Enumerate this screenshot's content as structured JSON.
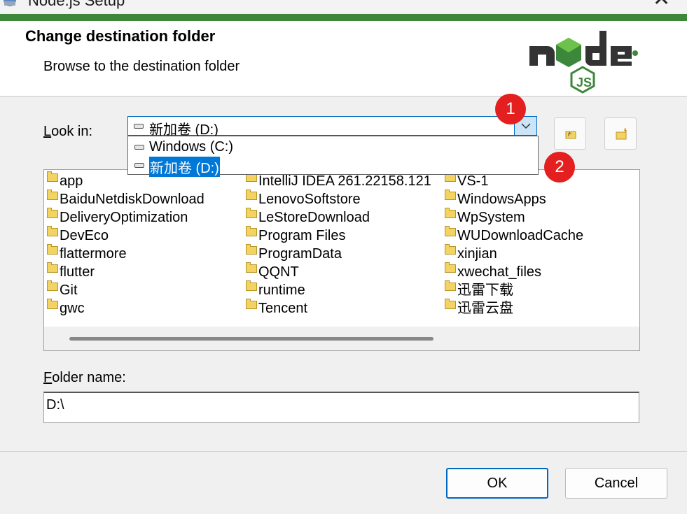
{
  "window": {
    "title": "Node.js Setup",
    "close_glyph": "✕"
  },
  "header": {
    "title": "Change destination folder",
    "subtitle": "Browse to the destination folder",
    "logo_icon": "nodejs-logo-icon"
  },
  "look_in": {
    "label_accel": "L",
    "label_rest": "ook in:",
    "selected": "新加卷 (D:)",
    "options": [
      "Windows (C:)",
      "新加卷 (D:)"
    ]
  },
  "toolbar": {
    "up_icon": "folder-up-icon",
    "new_folder_icon": "new-folder-icon"
  },
  "annotations": {
    "badge1": "1",
    "badge2": "2",
    "badge_color": "#e3201f"
  },
  "folders": {
    "col1": [
      "app",
      "BaiduNetdiskDownload",
      "DeliveryOptimization",
      "DevEco",
      "flattermore",
      "flutter",
      "Git",
      "gwc"
    ],
    "col2": [
      "IntelliJ IDEA 261.22158.121",
      "LenovoSoftstore",
      "LeStoreDownload",
      "Program Files",
      "ProgramData",
      "QQNT",
      "runtime",
      "Tencent"
    ],
    "col3": [
      "VS-1",
      "WindowsApps",
      "WpSystem",
      "WUDownloadCache",
      "xinjian",
      "xwechat_files",
      "迅雷下载",
      "迅雷云盘"
    ]
  },
  "folder_name": {
    "label_accel": "F",
    "label_rest": "older name:",
    "value": "D:\\"
  },
  "buttons": {
    "ok": "OK",
    "cancel": "Cancel"
  },
  "colors": {
    "accent": "#0067c0",
    "node_green": "#3c873a",
    "selection": "#0078d7"
  }
}
